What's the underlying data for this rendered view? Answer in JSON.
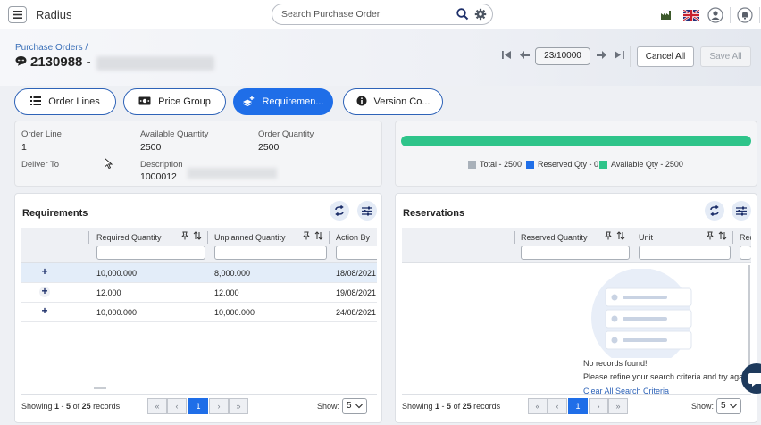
{
  "app": {
    "title": "Radius"
  },
  "search": {
    "placeholder": "Search Purchase Order"
  },
  "header": {
    "breadcrumb": "Purchase Orders /",
    "po_number": "2130988 -",
    "pager": "23/10000",
    "cancel_label": "Cancel All",
    "save_label": "Save All"
  },
  "tabs": [
    {
      "label": "Order Lines"
    },
    {
      "label": "Price Group"
    },
    {
      "label": "Requiremen..."
    },
    {
      "label": "Version Co..."
    }
  ],
  "order_info": {
    "order_line_label": "Order Line",
    "order_line_value": "1",
    "available_label": "Available Quantity",
    "available_value": "2500",
    "order_qty_label": "Order Quantity",
    "order_qty_value": "2500",
    "deliver_to_label": "Deliver To",
    "description_label": "Description",
    "description_value": "1000012"
  },
  "quantity_bar": {
    "available_fraction": 1.0,
    "legend": [
      {
        "label": "Total - 2500",
        "color": "#a9b1ba"
      },
      {
        "label": "Reserved Qty - 0",
        "color": "#1f6ee8"
      },
      {
        "label": "Available Qty - 2500",
        "color": "#2ec48a"
      }
    ]
  },
  "requirements": {
    "title": "Requirements",
    "columns": [
      "Required Quantity",
      "Unplanned Quantity",
      "Action By"
    ],
    "rows": [
      {
        "required": "10,000.000",
        "unplanned": "8,000.000",
        "action_by": "18/08/2021"
      },
      {
        "required": "12.000",
        "unplanned": "12.000",
        "action_by": "19/08/2021"
      },
      {
        "required": "10,000.000",
        "unplanned": "10,000.000",
        "action_by": "24/08/2021"
      }
    ],
    "footer": {
      "showing_prefix": "Showing ",
      "range": "1",
      "dash": " - ",
      "range_end": "5",
      "of": " of ",
      "total": "25",
      "suffix": " records",
      "page": "1",
      "show_label": "Show:",
      "page_size": "5"
    }
  },
  "reservations": {
    "title": "Reservations",
    "columns": [
      "Reserved Quantity",
      "Unit",
      "Req"
    ],
    "empty_title": "No records found!",
    "empty_hint": "Please refine your search criteria and try again",
    "empty_link": "Clear All Search Criteria",
    "footer": {
      "showing_prefix": "Showing ",
      "range": "1",
      "dash": " - ",
      "range_end": "5",
      "of": " of ",
      "total": "25",
      "suffix": " records",
      "page": "1",
      "show_label": "Show:",
      "page_size": "5"
    }
  },
  "colors": {
    "accent": "#1f6ee8",
    "available": "#2ec48a"
  }
}
